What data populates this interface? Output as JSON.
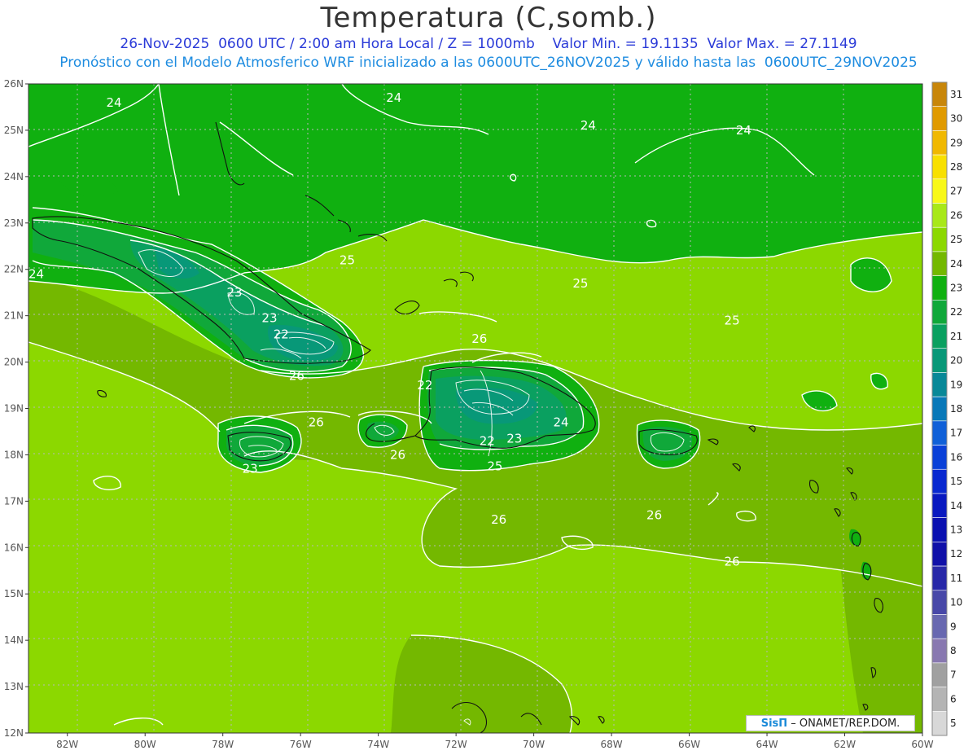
{
  "title": "Temperatura (C,somb.)",
  "subtitle_line1": "26-Nov-2025  0600 UTC / 2:00 am Hora Local / Z = 1000mb    Valor Min. = 19.1135  Valor Max. = 27.1149",
  "subtitle_line2": "Pronóstico con el Modelo Atmosferico WRF inicializado a las 0600UTC_26NOV2025 y válido hasta las  0600UTC_29NOV2025",
  "credit_logo": "SisΠ",
  "credit_text": " – ONAMET/REP.DOM.",
  "lat_labels": [
    "26N",
    "25N",
    "24N",
    "23N",
    "22N",
    "21N",
    "20N",
    "19N",
    "18N",
    "17N",
    "16N",
    "15N",
    "14N",
    "13N",
    "12N"
  ],
  "lon_labels": [
    "82W",
    "80W",
    "78W",
    "76W",
    "74W",
    "72W",
    "70W",
    "68W",
    "66W",
    "64W",
    "62W",
    "60W"
  ],
  "colorbar": {
    "levels": [
      "31",
      "30",
      "29",
      "28",
      "27",
      "26",
      "25",
      "24",
      "23",
      "22",
      "21",
      "20",
      "19",
      "18",
      "17",
      "16",
      "15",
      "14",
      "13",
      "12",
      "11",
      "10",
      "9",
      "8",
      "7",
      "6",
      "5"
    ],
    "colors": [
      "#c8860a",
      "#e09a00",
      "#f0b800",
      "#f8e000",
      "#f8f818",
      "#a8e818",
      "#8cd800",
      "#74b800",
      "#10b010",
      "#10a83a",
      "#0aa060",
      "#089878",
      "#088898",
      "#0878b8",
      "#1060d8",
      "#0a40d8",
      "#0828d0",
      "#0818c0",
      "#0a10b0",
      "#1010a8",
      "#2828a8",
      "#4848a8",
      "#6868b0",
      "#8878b0",
      "#a0a0a0",
      "#b4b4b4",
      "#d8d8d8"
    ]
  },
  "map": {
    "lat_range": [
      12,
      26
    ],
    "lon_range": [
      -83,
      -60
    ],
    "contour_labels": [
      {
        "text": "24",
        "lon": -80.8,
        "lat": 25.6
      },
      {
        "text": "24",
        "lon": -73.6,
        "lat": 25.7
      },
      {
        "text": "24",
        "lon": -68.6,
        "lat": 25.1
      },
      {
        "text": "24",
        "lon": -64.6,
        "lat": 25.0
      },
      {
        "text": "24",
        "lon": -82.8,
        "lat": 21.9
      },
      {
        "text": "23",
        "lon": -77.7,
        "lat": 21.5
      },
      {
        "text": "23",
        "lon": -76.8,
        "lat": 20.95
      },
      {
        "text": "22",
        "lon": -76.5,
        "lat": 20.6
      },
      {
        "text": "25",
        "lon": -74.8,
        "lat": 22.2
      },
      {
        "text": "25",
        "lon": -68.8,
        "lat": 21.7
      },
      {
        "text": "25",
        "lon": -64.9,
        "lat": 20.9
      },
      {
        "text": "26",
        "lon": -71.4,
        "lat": 20.5
      },
      {
        "text": "26",
        "lon": -76.1,
        "lat": 19.7
      },
      {
        "text": "26",
        "lon": -75.6,
        "lat": 18.7
      },
      {
        "text": "22",
        "lon": -72.8,
        "lat": 19.5
      },
      {
        "text": "24",
        "lon": -69.3,
        "lat": 18.7
      },
      {
        "text": "22",
        "lon": -71.2,
        "lat": 18.3
      },
      {
        "text": "23",
        "lon": -70.5,
        "lat": 18.35
      },
      {
        "text": "26",
        "lon": -73.5,
        "lat": 18.0
      },
      {
        "text": "23",
        "lon": -77.3,
        "lat": 17.7
      },
      {
        "text": "25",
        "lon": -71.0,
        "lat": 17.75
      },
      {
        "text": "26",
        "lon": -70.9,
        "lat": 16.6
      },
      {
        "text": "26",
        "lon": -66.9,
        "lat": 16.7
      },
      {
        "text": "26",
        "lon": -64.9,
        "lat": 15.7
      }
    ]
  }
}
